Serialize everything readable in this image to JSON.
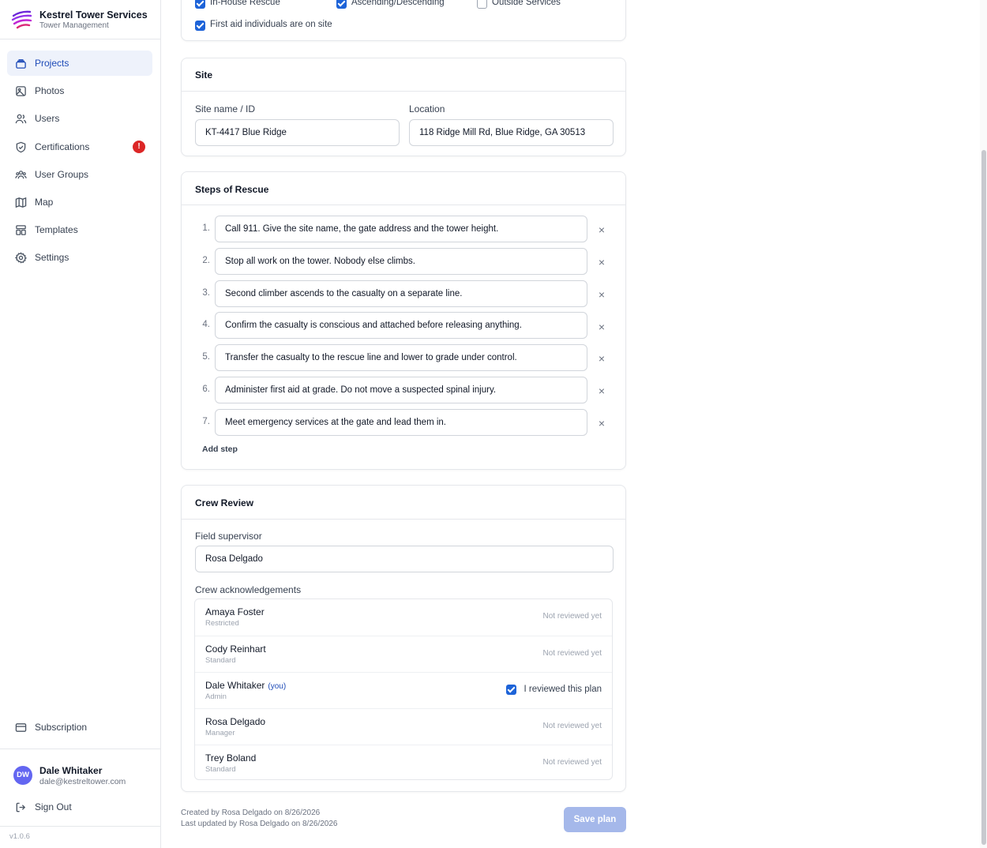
{
  "brand": {
    "name": "Kestrel Tower Services",
    "subtitle": "Tower Management"
  },
  "sidebar": {
    "items": [
      {
        "label": "Projects",
        "icon": "projects-icon",
        "active": true
      },
      {
        "label": "Photos",
        "icon": "photo-icon"
      },
      {
        "label": "Users",
        "icon": "users-icon"
      },
      {
        "label": "Certifications",
        "icon": "shield-check-icon",
        "badge": "!"
      },
      {
        "label": "User Groups",
        "icon": "user-groups-icon"
      },
      {
        "label": "Map",
        "icon": "map-icon"
      },
      {
        "label": "Templates",
        "icon": "templates-icon"
      },
      {
        "label": "Settings",
        "icon": "gear-icon"
      }
    ],
    "subscription": "Subscription",
    "user": {
      "initials": "DW",
      "name": "Dale Whitaker",
      "email": "dale@kestreltower.com"
    },
    "signout": "Sign Out",
    "version": "v1.0.6"
  },
  "rescue_type": {
    "options": [
      {
        "label": "In-House Rescue",
        "checked": true
      },
      {
        "label": "Ascending/Descending",
        "checked": true
      },
      {
        "label": "Outside Services",
        "checked": false
      }
    ],
    "first_aid": {
      "label": "First aid individuals are on site",
      "checked": true
    }
  },
  "site": {
    "title": "Site",
    "name_label": "Site name / ID",
    "name_value": "KT-4417 Blue Ridge",
    "location_label": "Location",
    "location_value": "118 Ridge Mill Rd, Blue Ridge, GA 30513"
  },
  "steps": {
    "title": "Steps of Rescue",
    "items": [
      {
        "num": "1.",
        "text": "Call 911. Give the site name, the gate address and the tower height."
      },
      {
        "num": "2.",
        "text": "Stop all work on the tower. Nobody else climbs."
      },
      {
        "num": "3.",
        "text": "Second climber ascends to the casualty on a separate line."
      },
      {
        "num": "4.",
        "text": "Confirm the casualty is conscious and attached before releasing anything."
      },
      {
        "num": "5.",
        "text": "Transfer the casualty to the rescue line and lower to grade under control."
      },
      {
        "num": "6.",
        "text": "Administer first aid at grade. Do not move a suspected spinal injury."
      },
      {
        "num": "7.",
        "text": "Meet emergency services at the gate and lead them in."
      }
    ],
    "add_label": "Add step"
  },
  "crew": {
    "title": "Crew Review",
    "supervisor_label": "Field supervisor",
    "supervisor_value": "Rosa Delgado",
    "ack_label": "Crew acknowledgements",
    "members": [
      {
        "name": "Amaya Foster",
        "role": "Restricted",
        "status": "Not reviewed yet"
      },
      {
        "name": "Cody Reinhart",
        "role": "Standard",
        "status": "Not reviewed yet"
      },
      {
        "name": "Dale Whitaker",
        "you": "(you)",
        "role": "Admin",
        "check_label": "I reviewed this plan",
        "checked": true
      },
      {
        "name": "Rosa Delgado",
        "role": "Manager",
        "status": "Not reviewed yet"
      },
      {
        "name": "Trey Boland",
        "role": "Standard",
        "status": "Not reviewed yet"
      }
    ]
  },
  "footer": {
    "created": "Created by Rosa Delgado on 8/26/2026",
    "updated": "Last updated by Rosa Delgado on 8/26/2026",
    "save_label": "Save plan"
  },
  "colors": {
    "accent": "#1d63d8",
    "badge": "#dc2626",
    "save_disabled": "#a5b8ea",
    "avatar": "#6366f1"
  }
}
